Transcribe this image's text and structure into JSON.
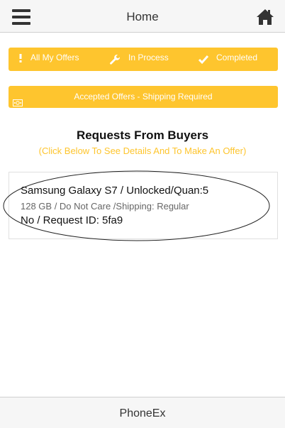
{
  "header": {
    "title": "Home",
    "menu_icon": "hamburger-menu-icon",
    "home_icon": "home-icon"
  },
  "nav": {
    "items": [
      {
        "label": "All My Offers",
        "icon": "exclamation-icon"
      },
      {
        "label": "In Process",
        "icon": "wrench-icon"
      },
      {
        "label": "Completed",
        "icon": "checkmark-icon"
      }
    ]
  },
  "accepted": {
    "label": "Accepted Offers - Shipping Required",
    "icon": "cash-icon"
  },
  "requests": {
    "title": "Requests From Buyers",
    "subtitle": "(Click Below To See Details And To Make An Offer)",
    "items": [
      {
        "line1": "Samsung Galaxy S7 / Unlocked/Quan:5",
        "line2": "128 GB / Do Not Care /Shipping: Regular",
        "line3": "No / Request ID: 5fa9"
      }
    ]
  },
  "footer": {
    "title": "PhoneEx"
  },
  "colors": {
    "accent": "#fec52e",
    "header_bg": "#f6f6f6"
  }
}
